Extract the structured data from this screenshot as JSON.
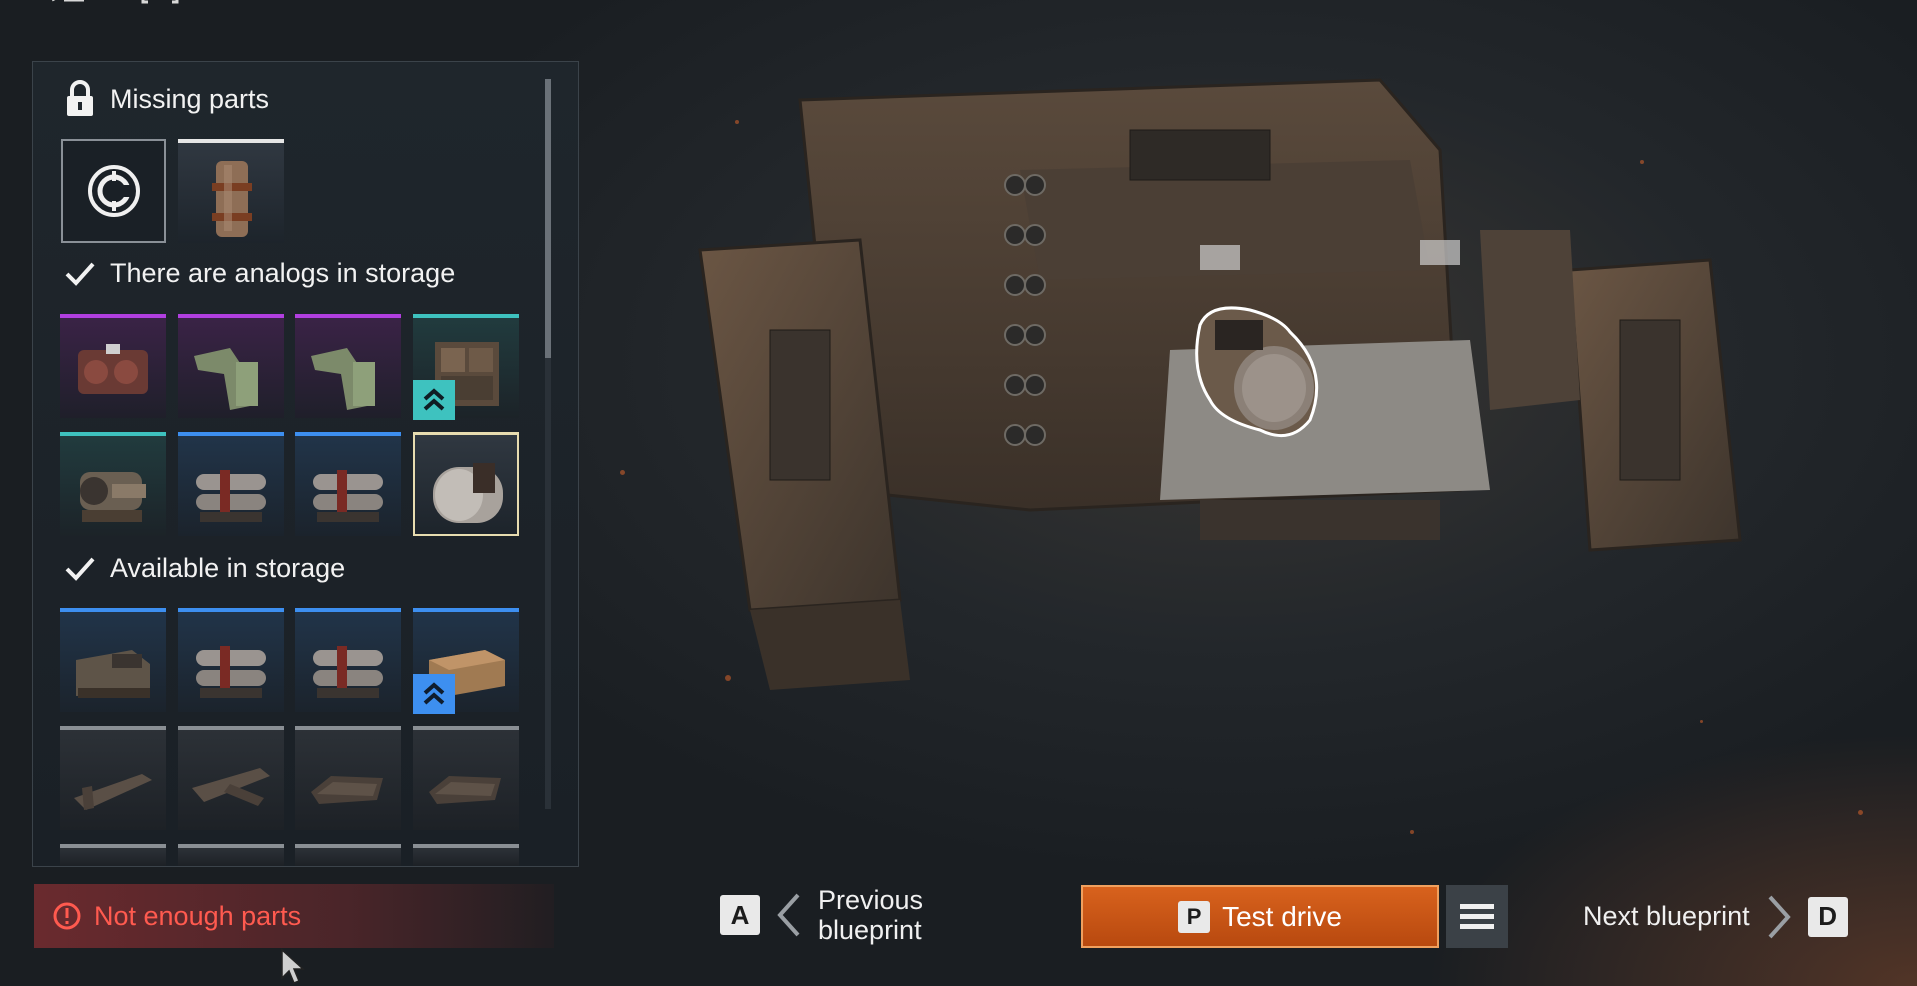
{
  "sections": {
    "missing": {
      "title": "Missing parts",
      "icon": "lock-icon"
    },
    "analogs": {
      "title": "There are analogs in storage",
      "icon": "check-icon"
    },
    "available": {
      "title": "Available in storage",
      "icon": "check-icon"
    }
  },
  "missing_parts": [
    {
      "type": "coin-icon",
      "rarity": "none"
    },
    {
      "type": "fuel-barrel",
      "rarity": "white"
    }
  ],
  "analog_parts": [
    {
      "type": "engine",
      "rarity": "purple"
    },
    {
      "type": "mech-arm",
      "rarity": "purple"
    },
    {
      "type": "mech-arm",
      "rarity": "purple"
    },
    {
      "type": "armor-block",
      "rarity": "teal",
      "upgrade": true
    },
    {
      "type": "cannon-engine",
      "rarity": "teal"
    },
    {
      "type": "twin-exhaust",
      "rarity": "blue"
    },
    {
      "type": "twin-exhaust",
      "rarity": "blue"
    },
    {
      "type": "fuel-tank",
      "rarity": "white",
      "selected": true
    }
  ],
  "available_parts": [
    {
      "type": "cabin",
      "rarity": "blue"
    },
    {
      "type": "twin-exhaust",
      "rarity": "blue"
    },
    {
      "type": "twin-exhaust",
      "rarity": "blue"
    },
    {
      "type": "crate",
      "rarity": "blue",
      "upgrade": true
    },
    {
      "type": "frame",
      "rarity": "gray"
    },
    {
      "type": "frame",
      "rarity": "gray"
    },
    {
      "type": "plate",
      "rarity": "gray"
    },
    {
      "type": "plate",
      "rarity": "gray"
    }
  ],
  "warning": {
    "text": "Not enough parts",
    "icon": "alert-icon",
    "color": "#ff5a4f"
  },
  "nav": {
    "prev_key": "A",
    "prev_line1": "Previous",
    "prev_line2": "blueprint",
    "test_key": "P",
    "test_label": "Test drive",
    "next_label": "Next blueprint",
    "next_key": "D"
  },
  "colors": {
    "accent": "#d8621d",
    "purple": "#b13fe0",
    "teal": "#3ec2bf",
    "blue": "#3d8ff0",
    "gray": "#8a8f94"
  }
}
